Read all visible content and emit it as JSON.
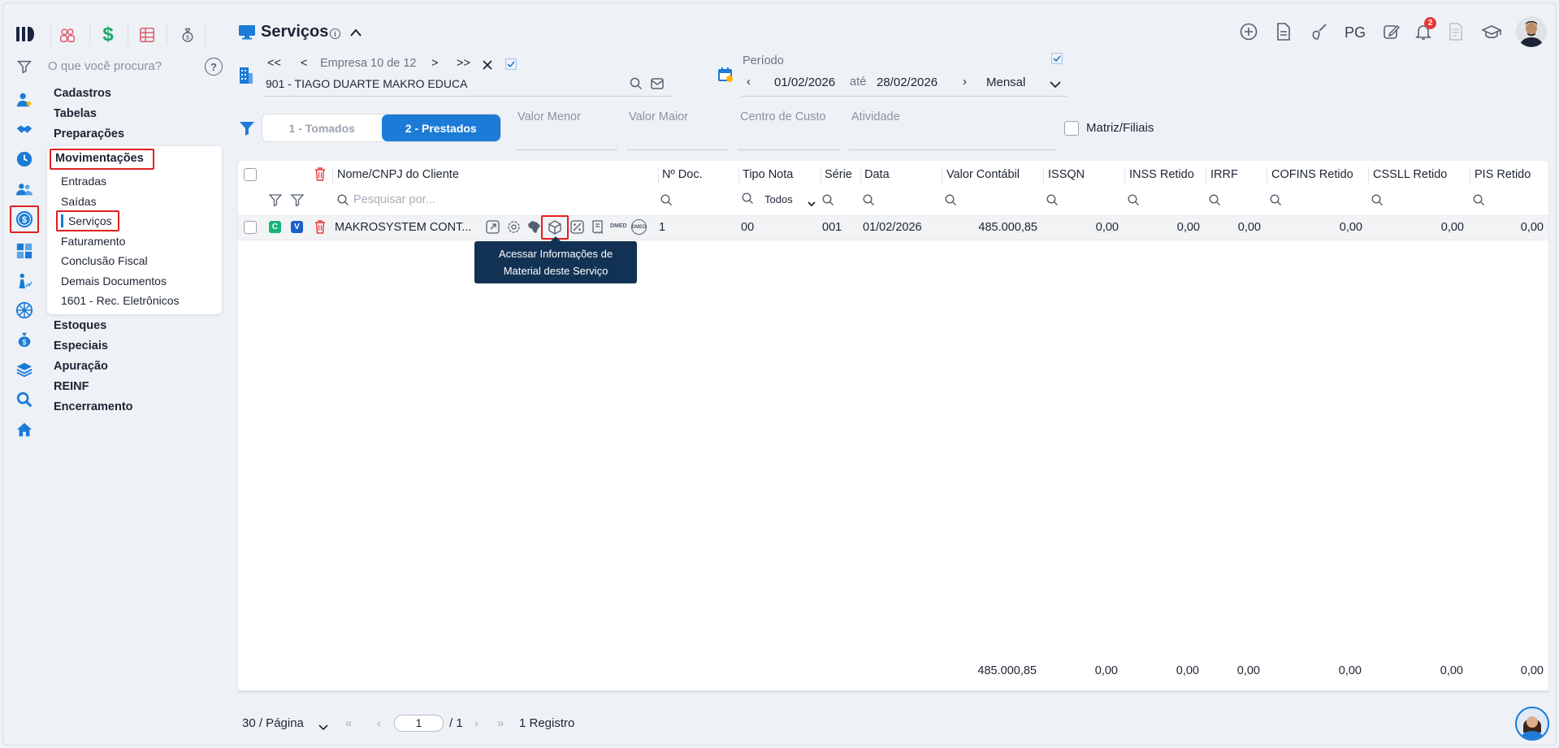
{
  "app": {
    "logo": "MD"
  },
  "search": {
    "placeholder": "O que você procura?"
  },
  "menu": {
    "items": [
      "Cadastros",
      "Tabelas",
      "Preparações",
      "Movimentações",
      "Estoques",
      "Especiais",
      "Apuração",
      "REINF",
      "Encerramento"
    ],
    "submenu": [
      "Entradas",
      "Saídas",
      "Serviços",
      "Faturamento",
      "Conclusão Fiscal",
      "Demais Documentos",
      "1601 - Rec. Eletrônicos"
    ]
  },
  "header": {
    "title": "Serviços",
    "empresa_nav": "Empresa 10 de 12",
    "empresa_first": "<<",
    "empresa_prev": "<",
    "empresa_next": ">",
    "empresa_last": ">>",
    "company": "901 - TIAGO DUARTE MAKRO EDUCA",
    "periodo_label": "Período",
    "date_from": "01/02/2026",
    "ate": "até",
    "date_to": "28/02/2026",
    "frequency": "Mensal",
    "pg_label": "PG",
    "notif_count": "2"
  },
  "filters": {
    "tab_tomados": "1 - Tomados",
    "tab_prestados": "2 - Prestados",
    "valor_menor": "Valor Menor",
    "valor_maior": "Valor Maior",
    "centro_custo": "Centro de Custo",
    "atividade": "Atividade",
    "matriz": "Matriz/Filiais"
  },
  "table": {
    "headers": {
      "nome": "Nome/CNPJ do Cliente",
      "ndoc": "Nº Doc.",
      "tipo": "Tipo Nota",
      "serie": "Série",
      "data": "Data",
      "valor": "Valor Contábil",
      "issqn": "ISSQN",
      "inss": "INSS Retido",
      "irrf": "IRRF",
      "cofins": "COFINS Retido",
      "csll": "CSSLL Retido",
      "pis": "PIS Retido"
    },
    "search_placeholder": "Pesquisar por...",
    "tipo_filter": "Todos",
    "row": {
      "badge_c": "C",
      "badge_v": "V",
      "dmed1": "DMED",
      "dmed2": "DMED",
      "nome": "MAKROSYSTEM CONT...",
      "ndoc": "1",
      "tipo": "00",
      "serie": "001",
      "data": "01/02/2026",
      "valor": "485.000,85",
      "issqn": "0,00",
      "inss": "0,00",
      "irrf": "0,00",
      "cofins": "0,00",
      "csll": "0,00",
      "pis": "0,00"
    },
    "totals": {
      "valor": "485.000,85",
      "issqn": "0,00",
      "inss": "0,00",
      "irrf": "0,00",
      "cofins": "0,00",
      "csll": "0,00",
      "pis": "0,00"
    }
  },
  "tooltip": {
    "line1": "Acessar Informações de",
    "line2": "Material deste Serviço"
  },
  "pagination": {
    "per_page": "30 / Página",
    "page": "1",
    "total_pages": "/ 1",
    "registros": "1 Registro"
  },
  "colors": {
    "accent": "#1c7bd6",
    "highlight": "#e0201f",
    "tooltip_bg": "#123254"
  }
}
